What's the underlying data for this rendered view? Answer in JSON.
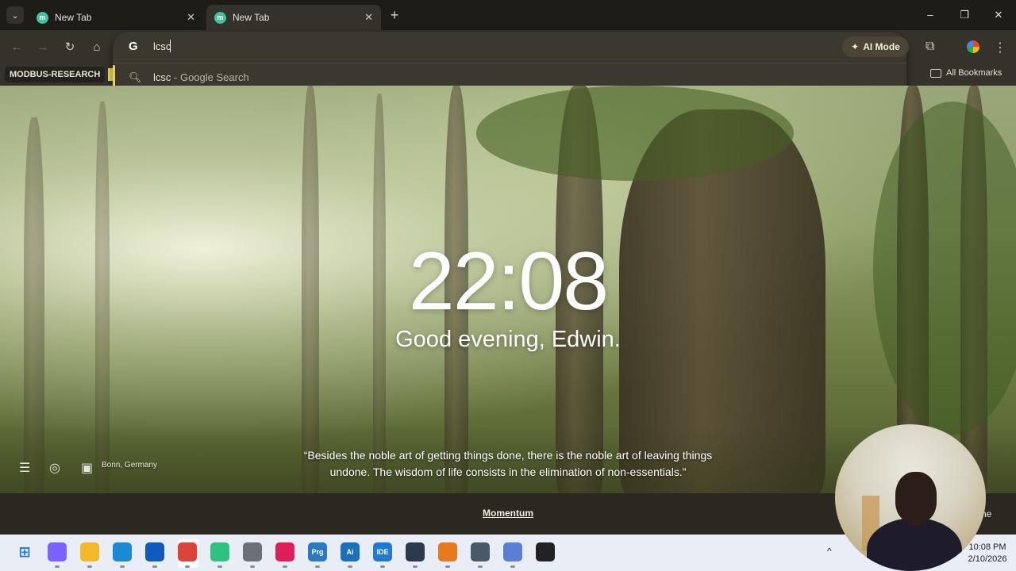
{
  "browser": {
    "tabs": [
      {
        "title": "New Tab",
        "active": false
      },
      {
        "title": "New Tab",
        "active": true
      }
    ],
    "new_tab_symbol": "+",
    "window_controls": {
      "minimize": "–",
      "restore": "❐",
      "close": "✕"
    },
    "nav": {
      "back": "←",
      "forward": "→",
      "reload": "↻",
      "home": "⌂"
    },
    "omnibox": {
      "engine_icon": "G",
      "typed_value": "lcsc",
      "suggestion": {
        "query": "lcsc",
        "suffix": "- Google Search"
      }
    },
    "ai_mode_label": "AI Mode",
    "extensions_icon": "puzzle-icon",
    "menu_icon": "⋮",
    "bookmarks": {
      "items": [
        "MODBUS-RESEARCH"
      ],
      "all_bookmarks_label": "All Bookmarks"
    }
  },
  "momentum": {
    "time": "22:08",
    "greeting": "Good evening, Edwin.",
    "quote": "“Besides the noble art of getting things done, there is the noble art of leaving things undone. The wisdom of life consists in the elimination of non-essentials.”",
    "location": "Bonn, Germany",
    "footer_link": "Momentum",
    "footer_right_partial": "ne"
  },
  "taskbar": {
    "apps": [
      {
        "name": "start",
        "color": "#1a73e8"
      },
      {
        "name": "copilot",
        "color": "#7b61ff"
      },
      {
        "name": "file-explorer",
        "color": "#f2b928"
      },
      {
        "name": "edge",
        "color": "#1a8ad4"
      },
      {
        "name": "outlook",
        "color": "#0f5bbd"
      },
      {
        "name": "chrome",
        "color": "#db4437"
      },
      {
        "name": "chatgpt",
        "color": "#2ec27e"
      },
      {
        "name": "app-gray",
        "color": "#6b6f78"
      },
      {
        "name": "slack",
        "color": "#e01e5a"
      },
      {
        "name": "prg",
        "label": "Prg",
        "color": "#2b78c5"
      },
      {
        "name": "arduino-ai",
        "label": "Ai",
        "color": "#1a6fbf"
      },
      {
        "name": "ide",
        "label": "IDE",
        "color": "#1f7ad6"
      },
      {
        "name": "app-dark",
        "color": "#2a3a4a"
      },
      {
        "name": "app-orange",
        "color": "#e57a1f"
      },
      {
        "name": "camera",
        "color": "#4a5a6a"
      },
      {
        "name": "app-cloud",
        "color": "#5b7fd6"
      },
      {
        "name": "app-record",
        "color": "#222"
      }
    ],
    "clock_time": "10:08 PM",
    "clock_date": "2/10/2026",
    "tray_up": "^"
  }
}
